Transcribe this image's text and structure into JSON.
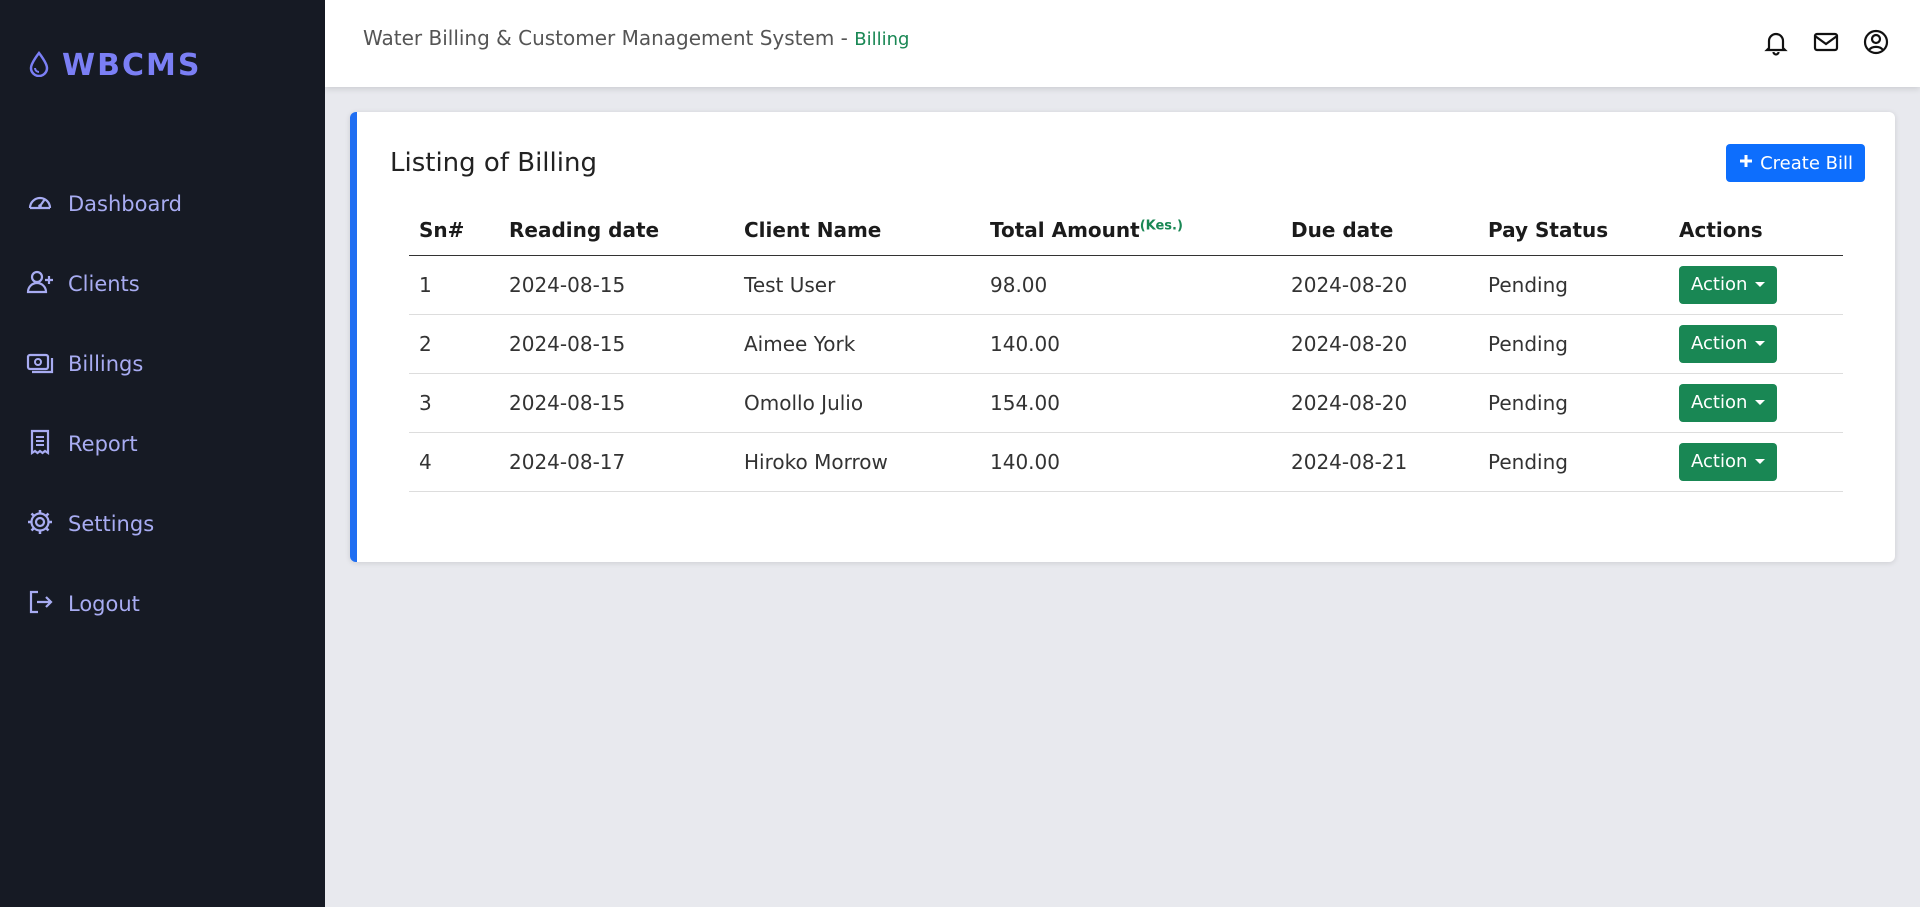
{
  "brand": {
    "name": "WBCMS"
  },
  "sidebar": {
    "items": [
      {
        "label": "Dashboard",
        "icon": "gauge-icon"
      },
      {
        "label": "Clients",
        "icon": "user-plus-icon"
      },
      {
        "label": "Billings",
        "icon": "cash-icon"
      },
      {
        "label": "Report",
        "icon": "receipt-icon"
      },
      {
        "label": "Settings",
        "icon": "gear-icon"
      },
      {
        "label": "Logout",
        "icon": "logout-icon"
      }
    ]
  },
  "header": {
    "title": "Water Billing & Customer Management System - ",
    "crumb": "Billing",
    "icons": [
      "bell-icon",
      "mail-icon",
      "user-circle-icon"
    ]
  },
  "card": {
    "title": "Listing of Billing",
    "create_label": "Create Bill"
  },
  "table": {
    "headers": {
      "sn": "Sn#",
      "reading_date": "Reading date",
      "client_name": "Client Name",
      "total_amount": "Total Amount",
      "currency": "(Kes.)",
      "due_date": "Due date",
      "pay_status": "Pay Status",
      "actions": "Actions"
    },
    "action_label": "Action",
    "rows": [
      {
        "sn": "1",
        "reading_date": "2024-08-15",
        "client_name": "Test User",
        "total_amount": "98.00",
        "due_date": "2024-08-20",
        "pay_status": "Pending"
      },
      {
        "sn": "2",
        "reading_date": "2024-08-15",
        "client_name": "Aimee York",
        "total_amount": "140.00",
        "due_date": "2024-08-20",
        "pay_status": "Pending"
      },
      {
        "sn": "3",
        "reading_date": "2024-08-15",
        "client_name": "Omollo Julio",
        "total_amount": "154.00",
        "due_date": "2024-08-20",
        "pay_status": "Pending"
      },
      {
        "sn": "4",
        "reading_date": "2024-08-17",
        "client_name": "Hiroko Morrow",
        "total_amount": "140.00",
        "due_date": "2024-08-21",
        "pay_status": "Pending"
      }
    ]
  },
  "colors": {
    "sidebar_bg": "#161a24",
    "brand": "#7b7ff5",
    "accent": "#1f6ef2",
    "success": "#198754"
  }
}
